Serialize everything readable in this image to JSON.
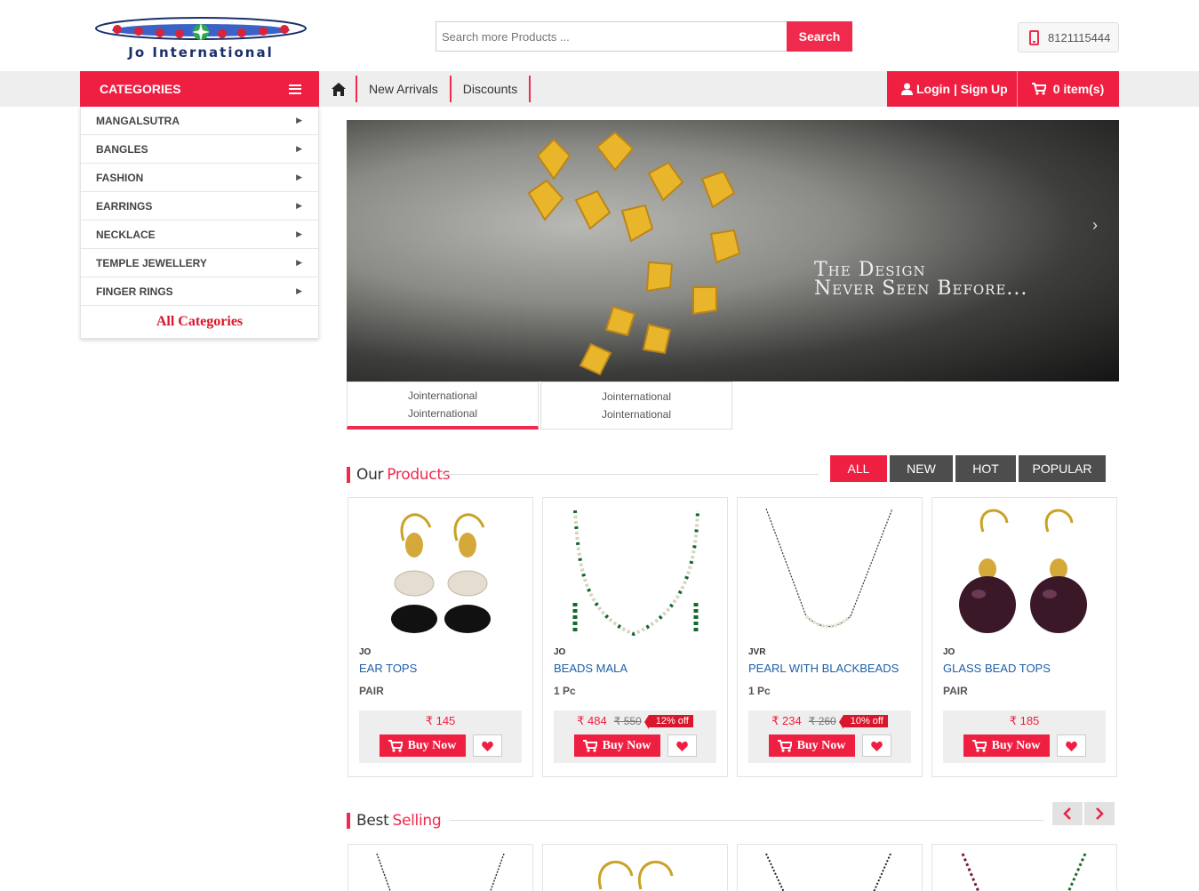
{
  "header": {
    "logo_text": "Jo International",
    "search_placeholder": "Search more Products ...",
    "search_label": "Search",
    "phone": "8121115444"
  },
  "nav": {
    "categories_label": "CATEGORIES",
    "links": [
      "New Arrivals",
      "Discounts"
    ],
    "login_label": "Login | Sign Up",
    "cart_label": "0 item(s)"
  },
  "categories": {
    "items": [
      "MANGALSUTRA",
      "BANGLES",
      "FASHION",
      "EARRINGS",
      "NECKLACE",
      "TEMPLE JEWELLERY",
      "FINGER RINGS"
    ],
    "all_label": "All Categories"
  },
  "banner": {
    "line1": "The Design",
    "line2": "Never Seen Before...",
    "tabs": [
      {
        "line1": "Jointernational",
        "line2": "Jointernational"
      },
      {
        "line1": "Jointernational",
        "line2": "Jointernational"
      }
    ]
  },
  "products_section": {
    "title_a": "Our",
    "title_b": "Products",
    "filters": [
      "ALL",
      "NEW",
      "HOT",
      "POPULAR"
    ],
    "active_filter": "ALL"
  },
  "products": [
    {
      "brand": "JO",
      "name": "EAR TOPS",
      "unit": "PAIR",
      "price": "₹ 145",
      "mrp": "",
      "discount": "",
      "buy_label": "Buy Now"
    },
    {
      "brand": "JO",
      "name": "BEADS MALA",
      "unit": "1 Pc",
      "price": "₹ 484",
      "mrp": "₹ 550",
      "discount": "12% off",
      "buy_label": "Buy Now"
    },
    {
      "brand": "JVR",
      "name": "PEARL WITH BLACKBEADS",
      "unit": "1 Pc",
      "price": "₹ 234",
      "mrp": "₹ 260",
      "discount": "10% off",
      "buy_label": "Buy Now"
    },
    {
      "brand": "JO",
      "name": "GLASS BEAD TOPS",
      "unit": "PAIR",
      "price": "₹ 185",
      "mrp": "",
      "discount": "",
      "buy_label": "Buy Now"
    }
  ],
  "best_selling": {
    "title_a": "Best",
    "title_b": "Selling"
  },
  "colors": {
    "accent": "#ef1f42",
    "link": "#1d5fa8",
    "dark_tab": "#4d4d4d"
  }
}
